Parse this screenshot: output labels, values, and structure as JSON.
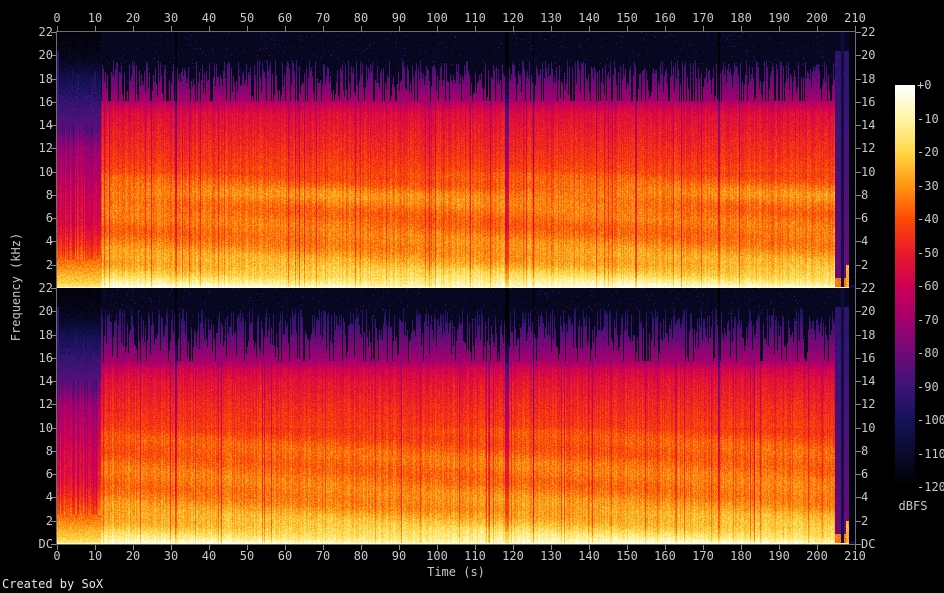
{
  "app": {
    "footer": "Created by SoX"
  },
  "colors": {
    "background": "#000000",
    "frame": "#6f6f6f",
    "tick": "#8a8a8a",
    "label_text": "#c8c8c8",
    "footer_text": "#e9e9e9"
  },
  "chart_data": {
    "type": "heatmap",
    "subtype": "audio-spectrogram-stereo",
    "title": "",
    "xlabel": "Time (s)",
    "ylabel": "Frequency (kHz)",
    "channels": 2,
    "x_range_s": [
      0,
      210
    ],
    "x_ticks": [
      0,
      10,
      20,
      30,
      40,
      50,
      60,
      70,
      80,
      90,
      100,
      110,
      120,
      130,
      140,
      150,
      160,
      170,
      180,
      190,
      200,
      210
    ],
    "y_range_khz": [
      0,
      22
    ],
    "y_ticks": [
      {
        "v": 22,
        "label": "22"
      },
      {
        "v": 20,
        "label": "20"
      },
      {
        "v": 18,
        "label": "18"
      },
      {
        "v": 16,
        "label": "16"
      },
      {
        "v": 14,
        "label": "14"
      },
      {
        "v": 12,
        "label": "12"
      },
      {
        "v": 10,
        "label": "10"
      },
      {
        "v": 8,
        "label": "8"
      },
      {
        "v": 6,
        "label": "6"
      },
      {
        "v": 4,
        "label": "4"
      },
      {
        "v": 2,
        "label": "2"
      },
      {
        "v": 0,
        "label": "DC"
      }
    ],
    "colorbar": {
      "label": "dBFS",
      "range_db": [
        -120,
        0
      ],
      "tick_labels": [
        "+0",
        "-10",
        "-20",
        "-30",
        "-40",
        "-50",
        "-60",
        "-70",
        "-80",
        "-90",
        "-100",
        "-110",
        "-120"
      ],
      "palette": [
        {
          "pos": 0.0,
          "color": "#000000"
        },
        {
          "pos": 0.083,
          "color": "#0a0a2e"
        },
        {
          "pos": 0.167,
          "color": "#16125a"
        },
        {
          "pos": 0.25,
          "color": "#3c1478"
        },
        {
          "pos": 0.333,
          "color": "#6f0a78"
        },
        {
          "pos": 0.417,
          "color": "#a4006e"
        },
        {
          "pos": 0.5,
          "color": "#cd0054"
        },
        {
          "pos": 0.583,
          "color": "#e91a28"
        },
        {
          "pos": 0.667,
          "color": "#fc4b04"
        },
        {
          "pos": 0.75,
          "color": "#ff9612"
        },
        {
          "pos": 0.833,
          "color": "#ffd747"
        },
        {
          "pos": 0.917,
          "color": "#fff5a5"
        },
        {
          "pos": 1.0,
          "color": "#ffffff"
        }
      ]
    },
    "content": {
      "intro_end_s": 11.4,
      "music_end_s": 204.6,
      "notches_s": [
        31.2,
        118.3,
        125.3,
        174.1
      ],
      "notch_widths_s": [
        0.45,
        1.2,
        0.45,
        0.55
      ],
      "notch_depth_db": [
        26,
        30,
        26,
        26
      ],
      "outro": {
        "bursts_s": [
          [
            204.6,
            206.3
          ],
          [
            207.0,
            208.4
          ]
        ],
        "burst_level_db": -80,
        "burst_bottom_db": -34,
        "gap_level_db": -102,
        "silence_from_s": 208.4,
        "silence_level_db": -117
      },
      "dc_line_db": -6,
      "noise_floor_db": -119,
      "channel_profiles_music": [
        [
          [
            0,
            -2
          ],
          [
            0.3,
            -9
          ],
          [
            1,
            -18
          ],
          [
            2,
            -26
          ],
          [
            3.5,
            -32
          ],
          [
            5,
            -36
          ],
          [
            6.5,
            -36
          ],
          [
            8,
            -32
          ],
          [
            9,
            -38
          ],
          [
            11,
            -44
          ],
          [
            13,
            -49
          ],
          [
            15,
            -55
          ],
          [
            15.8,
            -63
          ],
          [
            16.4,
            -76
          ],
          [
            17.2,
            -96
          ],
          [
            19,
            -109
          ],
          [
            20,
            -116
          ],
          [
            22,
            -119
          ]
        ],
        [
          [
            0,
            -4
          ],
          [
            0.5,
            -13
          ],
          [
            1.5,
            -22
          ],
          [
            3,
            -30
          ],
          [
            5,
            -35
          ],
          [
            7,
            -36
          ],
          [
            8.5,
            -39
          ],
          [
            10,
            -43
          ],
          [
            12,
            -47
          ],
          [
            14,
            -53
          ],
          [
            15,
            -59
          ],
          [
            15.7,
            -70
          ],
          [
            16.3,
            -86
          ],
          [
            17.5,
            -99
          ],
          [
            19.5,
            -109
          ],
          [
            20.6,
            -116
          ],
          [
            22,
            -119
          ]
        ]
      ],
      "profile_intro": [
        [
          0,
          -13
        ],
        [
          0.5,
          -21
        ],
        [
          1.5,
          -29
        ],
        [
          2.5,
          -37
        ],
        [
          4,
          -47
        ],
        [
          5.5,
          -55
        ],
        [
          8,
          -59
        ],
        [
          10,
          -65
        ],
        [
          12,
          -71
        ],
        [
          13.5,
          -83
        ],
        [
          16,
          -93
        ],
        [
          18,
          -103
        ],
        [
          19.5,
          -113
        ],
        [
          22,
          -119
        ]
      ],
      "streak_bands": [
        {
          "lo": 16.1,
          "hi": 19.6,
          "gap_p": 0.18
        },
        {
          "lo": 15.7,
          "hi": 20.3,
          "gap_p": 0.1
        }
      ],
      "intro_streaks": {
        "lo": 12.5,
        "hi": 19.0,
        "p": 0.5
      },
      "lead_in_spike_s": 0.45
    }
  }
}
